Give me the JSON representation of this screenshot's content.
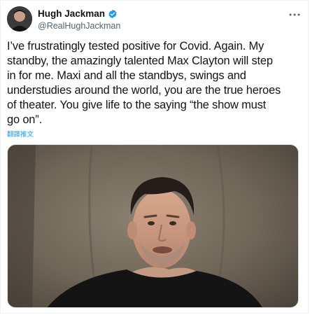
{
  "author": {
    "display_name": "Hugh Jackman",
    "handle": "@RealHughJackman",
    "verified": true,
    "verified_color": "#1d9bf0"
  },
  "tweet": {
    "text": "I’ve frustratingly tested positive for Covid. Again. My\nstandby, the amazingly talented Max Clayton will step\nin for me. Maxi and all the standbys, swings  and\nunderstudies around the world, you are the true heroes\nof theater. You give life to the saying “the show must\ngo on”.",
    "translate_label": "翻譯推文"
  },
  "media": {
    "icon": "video-thumbnail"
  },
  "icons": {
    "more": "more-icon",
    "verified": "verified-badge-icon"
  }
}
